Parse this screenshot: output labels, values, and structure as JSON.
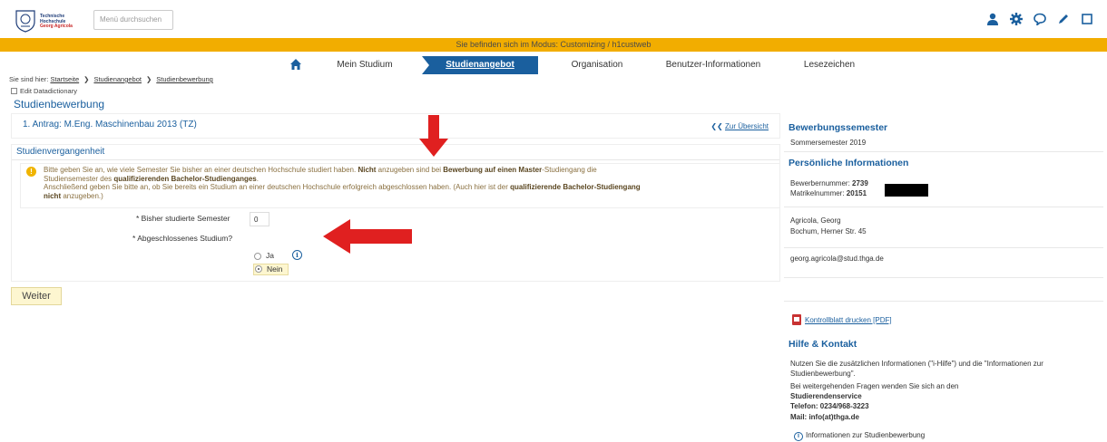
{
  "header": {
    "logo_lines": [
      "Technische",
      "Hochschule",
      "Georg Agricola"
    ],
    "search_placeholder": "Menü durchsuchen",
    "icons": [
      "user-icon",
      "gear-icon",
      "chat-icon",
      "pencil-icon",
      "window-icon"
    ]
  },
  "mode_banner": "Sie befinden sich im Modus: Customizing / h1custweb",
  "nav": {
    "home_icon": "home-icon",
    "tabs": [
      "Mein Studium",
      "Studienangebot",
      "Organisation",
      "Benutzer-Informationen",
      "Lesezeichen"
    ],
    "active_index": 1
  },
  "breadcrumb": {
    "prefix": "Sie sind hier:",
    "items": [
      "Startseite",
      "Studienangebot",
      "Studienbewerbung"
    ]
  },
  "edit_datadictionary": "Edit Datadictionary",
  "page_title": "Studienbewerbung",
  "antrag": {
    "title": "1. Antrag: M.Eng. Maschinenbau 2013 (TZ)",
    "back_link": "Zur Übersicht"
  },
  "section": {
    "title": "Studienvergangenheit",
    "info_parts": [
      "Bitte geben Sie an, wie viele Semester Sie bisher an einer deutschen Hochschule studiert haben. ",
      "Nicht",
      " anzugeben sind bei ",
      "Bewerbung auf einen Master",
      "-Studiengang die",
      "Studiensemester des ",
      "qualifizierenden Bachelor-Studienganges",
      ".",
      "Anschließend geben Sie bitte an, ob Sie bereits ein Studium an einer deutschen Hochschule erfolgreich abgeschlossen haben. (Auch hier ist der ",
      "qualifizierende Bachelor-Studiengang",
      "nicht",
      " anzugeben.)"
    ],
    "semester_label": "* Bisher studierte Semester",
    "semester_value": "0",
    "abgeschlossen_label": "* Abgeschlossenes Studium?",
    "options": [
      "Ja",
      "Nein"
    ],
    "selected": "Nein"
  },
  "weiter_button": "Weiter",
  "sidebar": {
    "semester_title": "Bewerbungssemester",
    "semester_value": "Sommersemester 2019",
    "personal_title": "Persönliche Informationen",
    "bewerber_label": "Bewerbernummer: ",
    "bewerber_value": "2739",
    "matrikel_label": "Matrikelnummer: ",
    "matrikel_value": "20151",
    "name": "Agricola, Georg",
    "address": "Bochum, Herner Str. 45",
    "email": "georg.agricola@stud.thga.de",
    "pdf_link": "Kontrollblatt drucken [PDF]",
    "help_title": "Hilfe & Kontakt",
    "help_line1": "Nutzen Sie die zusätzlichen Informationen (\"i-Hilfe\") und die \"Informationen zur",
    "help_line2": "Studienbewerbung\".",
    "help_line3": "Bei weitergehenden Fragen wenden Sie sich an den",
    "help_service": "Studierendenservice",
    "help_phone": "Telefon: 0234/968-3223",
    "help_mail": "Mail: info(at)thga.de",
    "help_info_link": "Informationen zur Studienbewerbung"
  },
  "annotation_colors": {
    "arrow": "#e02020",
    "accent": "#1a5f9e",
    "banner": "#f2ad00"
  }
}
